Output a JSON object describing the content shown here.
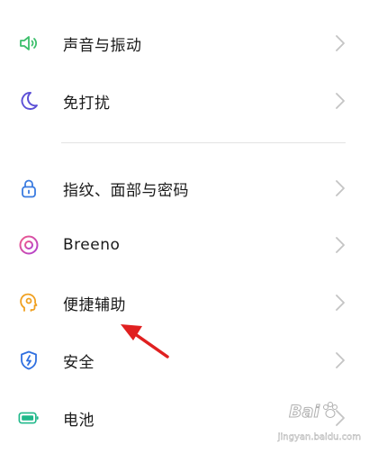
{
  "settings": {
    "items": [
      {
        "label": "声音与振动",
        "icon": "speaker-icon",
        "color": "#3cbf6b"
      },
      {
        "label": "免打扰",
        "icon": "moon-icon",
        "color": "#5b4fd6"
      },
      {
        "label": "指纹、面部与密码",
        "icon": "lock-icon",
        "color": "#3a7be0"
      },
      {
        "label": "Breeno",
        "icon": "breeno-icon",
        "color": "#e0409a"
      },
      {
        "label": "便捷辅助",
        "icon": "head-gear-icon",
        "color": "#f0a020"
      },
      {
        "label": "安全",
        "icon": "shield-bolt-icon",
        "color": "#2f6fe0"
      },
      {
        "label": "电池",
        "icon": "battery-icon",
        "color": "#1fb88a"
      }
    ]
  },
  "annotation": {
    "arrow_color": "#e02020"
  },
  "watermark": {
    "brand": "Bai",
    "sub": "jingyan.baidu.com"
  }
}
